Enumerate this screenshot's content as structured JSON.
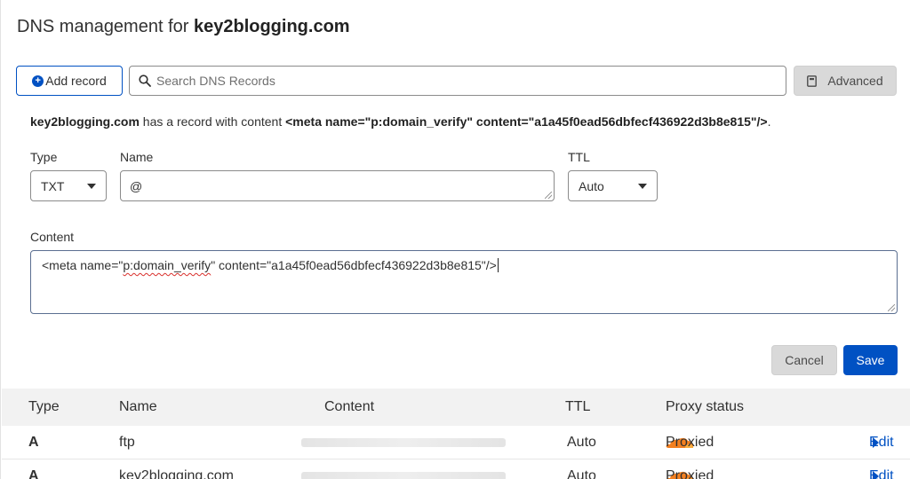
{
  "header": {
    "title_prefix": "DNS management for",
    "domain": "key2blogging.com"
  },
  "toolbar": {
    "add_label": "Add record",
    "search_placeholder": "Search DNS Records",
    "advanced_label": "Advanced"
  },
  "info": {
    "domain": "key2blogging.com",
    "text": " has a record with content ",
    "content": "<meta name=\"p:domain_verify\" content=\"a1a45f0ead56dbfecf436922d3b8e815\"/>",
    "end": "."
  },
  "form": {
    "type_label": "Type",
    "type_value": "TXT",
    "name_label": "Name",
    "name_value": "@",
    "ttl_label": "TTL",
    "ttl_value": "Auto",
    "content_label": "Content",
    "content_part1": "<meta name=\"",
    "content_squiggle": "p:domain_verify",
    "content_part2": "\" content=\"a1a45f0ead56dbfecf436922d3b8e815\"/>",
    "cancel_label": "Cancel",
    "save_label": "Save"
  },
  "table": {
    "headers": {
      "type": "Type",
      "name": "Name",
      "content": "Content",
      "ttl": "TTL",
      "proxy": "Proxy status"
    },
    "rows": [
      {
        "type": "A",
        "name": "ftp",
        "ttl": "Auto",
        "proxy": "Proxied",
        "edit": "Edit"
      },
      {
        "type": "A",
        "name": "key2blogging.com",
        "ttl": "Auto",
        "proxy": "Proxied",
        "edit": "Edit"
      }
    ]
  },
  "colors": {
    "accent": "#0051c3",
    "cloud": "#f38020"
  },
  "icons": {
    "add": "plus-circle-icon",
    "search": "search-icon",
    "advanced": "book-icon",
    "proxy": "cloud-icon",
    "edit": "caret-right-icon"
  }
}
